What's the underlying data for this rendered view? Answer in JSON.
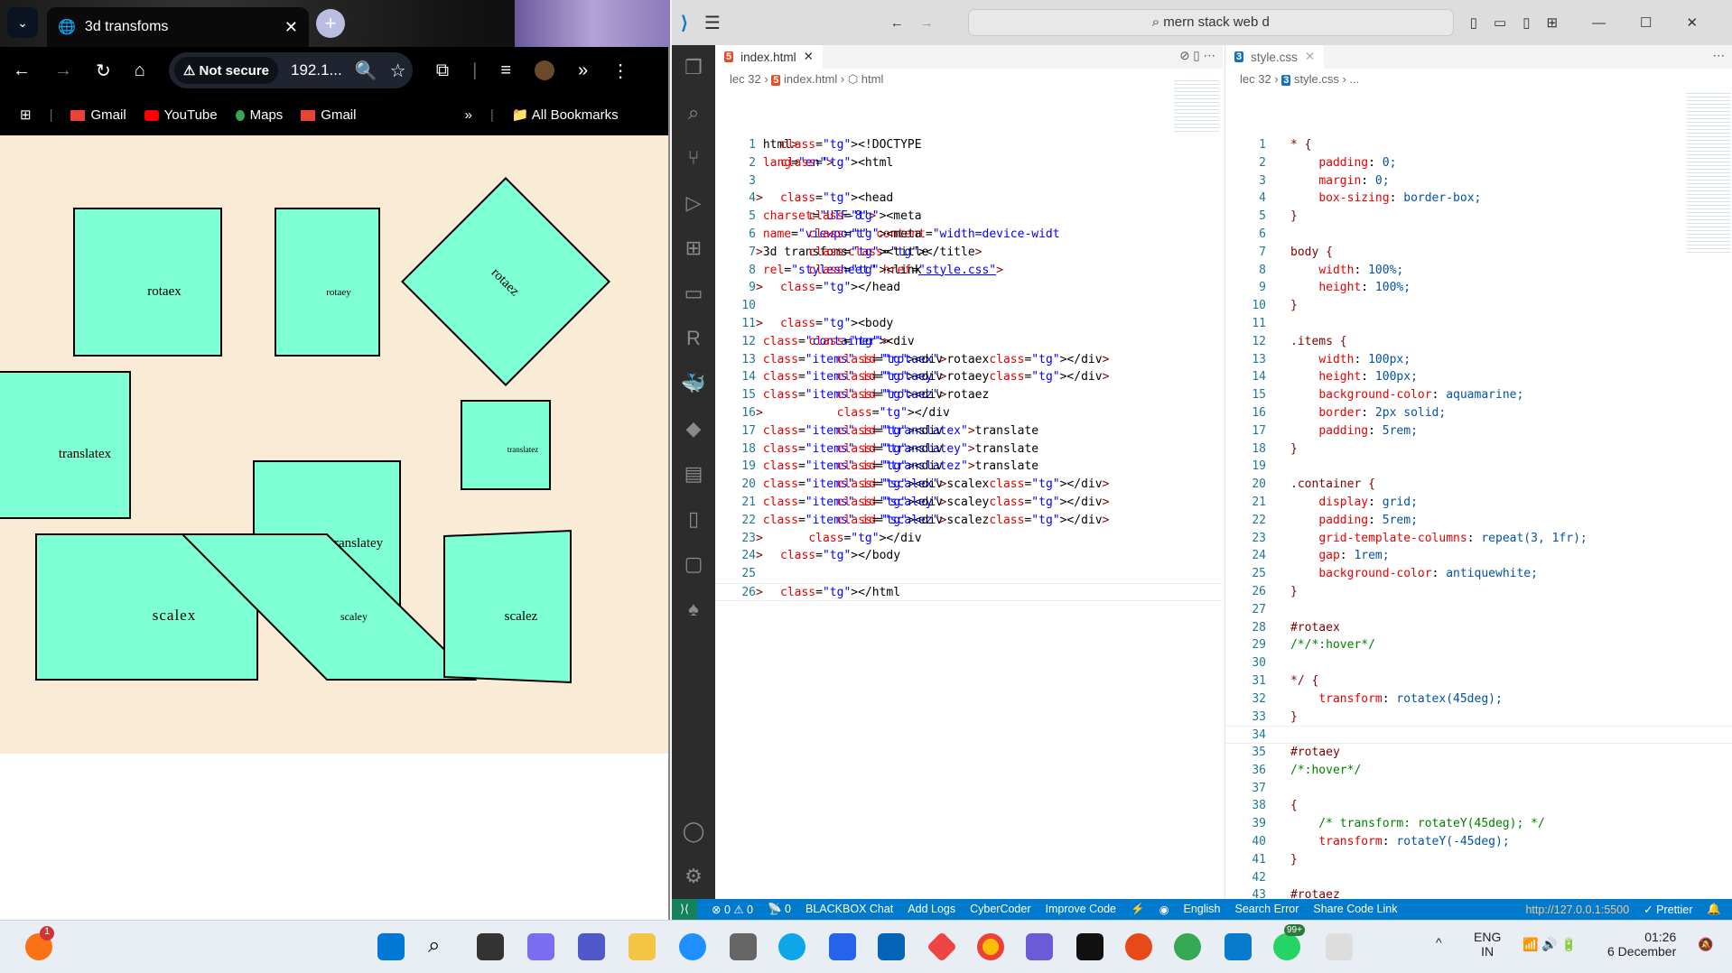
{
  "browser": {
    "tab_title": "3d transfoms",
    "security": "Not secure",
    "url": "192.1...",
    "bookmarks": [
      {
        "label": "Gmail",
        "color": "#ea4335"
      },
      {
        "label": "YouTube",
        "color": "#ff0000"
      },
      {
        "label": "Maps",
        "color": "#34a853"
      },
      {
        "label": "Gmail",
        "color": "#ea4335"
      }
    ],
    "all_bookmarks": "All Bookmarks",
    "page": {
      "background": "#faebd7",
      "item_color": "#7fffd4",
      "items": [
        "rotaex",
        "rotaey",
        "rotaez",
        "translatex",
        "translatez",
        "translatey",
        "scalex",
        "scaley",
        "scalez"
      ]
    }
  },
  "vscode": {
    "search": "mern stack web d",
    "left": {
      "tab": "index.html",
      "breadcrumb": [
        "lec 32",
        "index.html",
        "html"
      ],
      "lines": [
        "<!DOCTYPE html>",
        "<html lang=\"en\">",
        "",
        "<head>",
        "    <meta charset=\"UTF-8\">",
        "    <meta name=\"viewport\" content=\"width=device-widt",
        "    <title>3d transfoms</title>",
        "    <link rel=\"stylesheet\" href=\"style.css\">",
        "</head>",
        "",
        "<body>",
        "    <div class=\"container\">",
        "        <div class=\"items\" id=\"rotaex\">rotaex</div>",
        "        <div class=\"items\" id=\"rotaey\">rotaey</div>",
        "        <div class=\"items\" id=\"rotaez\">rotaez",
        "        </div>",
        "        <div class=\"items\" id=\"translatex\">translate",
        "        <div class=\"items\" id=\"translatey\">translate",
        "        <div class=\"items\" id=\"translatez\">translate",
        "        <div class=\"items\" id=\"scalex\">scalex</div>",
        "        <div class=\"items\" id=\"scaley\">scaley</div>",
        "        <div class=\"items\" id=\"scalez\">scalez</div>",
        "    </div>",
        "</body>",
        "",
        "</html>"
      ]
    },
    "right": {
      "tab": "style.css",
      "breadcrumb": [
        "lec 32",
        "style.css",
        "..."
      ],
      "lines": [
        "* {",
        "    padding: 0;",
        "    margin: 0;",
        "    box-sizing: border-box;",
        "}",
        "",
        "body {",
        "    width: 100%;",
        "    height: 100%;",
        "}",
        "",
        ".items {",
        "    width: 100px;",
        "    height: 100px;",
        "    background-color: aquamarine;",
        "    border: 2px solid;",
        "    padding: 5rem;",
        "}",
        "",
        ".container {",
        "    display: grid;",
        "    padding: 5rem;",
        "    grid-template-columns: repeat(3, 1fr);",
        "    gap: 1rem;",
        "    background-color: antiquewhite;",
        "}",
        "",
        "#rotaex",
        "/*/*:hover*/",
        "",
        "*/ {",
        "    transform: rotatex(45deg);",
        "}",
        "",
        "#rotaey",
        "/*:hover*/",
        "",
        "{",
        "    /* transform: rotateY(45deg); */",
        "    transform: rotateY(-45deg);",
        "}",
        "",
        "#rotaez",
        "/*:hover*/",
        ""
      ]
    },
    "status": [
      "⊗ 0 ⚠ 0",
      "📡 0",
      "BLACKBOX Chat",
      "Add Logs",
      "CyberCoder",
      "Improve Code",
      "⚡",
      "◉",
      "English",
      "Search Error",
      "Share Code Link"
    ],
    "status_right": [
      "http://127.0.0.1:5500",
      "✓ Prettier"
    ]
  },
  "taskbar": {
    "lang": "ENG",
    "region": "IN",
    "time": "01:26",
    "date": "6 December",
    "notification_badge": "1",
    "whatsapp_badge": "99+"
  }
}
